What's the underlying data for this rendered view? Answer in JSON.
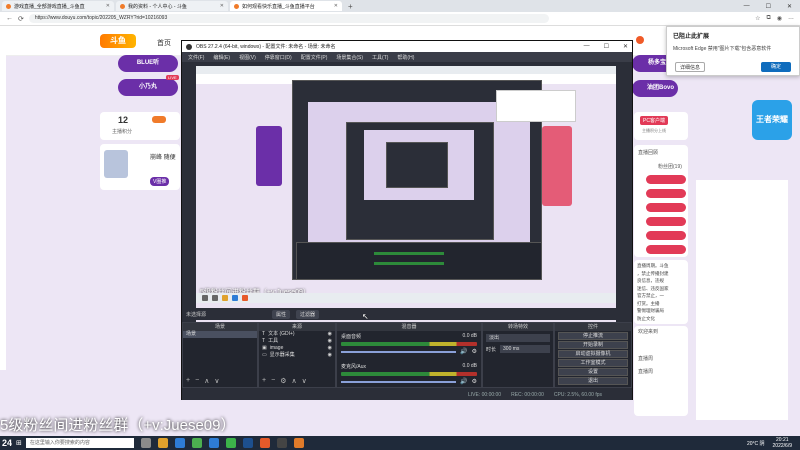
{
  "browser": {
    "tabs": [
      {
        "label": "游戏直播_全部游戏直播_斗鱼直",
        "active": false
      },
      {
        "label": "我的资料 - 个人中心 - 斗鱼",
        "active": false
      },
      {
        "label": "如何观看快乐直播_斗鱼直播平台",
        "active": true
      }
    ],
    "url": "https://www.douyu.com/topic/202205_WZRY?rid=10216093",
    "back": "←",
    "refresh": "⟳"
  },
  "douyu": {
    "logo": "斗鱼",
    "home": "首页",
    "pill_left_1": "BLUE听",
    "pill_left_2": "小乃丸",
    "live_badge": "LIVE",
    "stat_num": "12",
    "stat_label": "主播积分",
    "pill_right_1": "杨多宝·王",
    "pill_right_2": "油团Bovo",
    "pc_download": "PC客户端",
    "pc_download_sub": "主播积分上线",
    "right_promo": "王者荣耀",
    "list_title_1": "直播回顾",
    "list_title_2": "粉丝团(19)",
    "notice_fragments": [
      "直播周期。斗鱼",
      "，禁止传播封建",
      "良信息，违规",
      "迷信、违反国家",
      "官方禁止，一",
      "打赏。主播",
      "警惕理财骗局",
      "防止文化"
    ],
    "promo_text": "欢迎来到",
    "left_user": "崩峰 随便",
    "vip_badge": "V圈推",
    "sidebar_labels": [
      "直播周",
      "直播周"
    ]
  },
  "obs": {
    "title": "OBS 27.2.4 (64-bit, windows) - 配置文件: 未命名 - 场景: 未命名",
    "menu": [
      "文件(F)",
      "编辑(E)",
      "视图(V)",
      "停靠窗口(D)",
      "配置文件(P)",
      "场景集合(S)",
      "工具(T)",
      "帮助(H)"
    ],
    "scene_label": "未选择源",
    "toolbar_buttons": [
      "属性",
      "过滤器"
    ],
    "docks": {
      "scenes": {
        "title": "场景",
        "items": [
          "场景"
        ]
      },
      "sources": {
        "title": "来源",
        "items": [
          "文本 (GDI+)",
          "工具",
          "image",
          "显示器采集"
        ]
      },
      "mixer": {
        "title": "混音器",
        "channels": [
          {
            "name": "桌面音频",
            "db": "0.0 dB"
          },
          {
            "name": "麦克风/Aux",
            "db": "0.0 dB"
          }
        ]
      },
      "transitions": {
        "title": "转场特效",
        "type": "淡出",
        "duration_label": "时长",
        "duration": "300 ms"
      },
      "controls": {
        "title": "控件",
        "buttons": [
          "停止推流",
          "开始录制",
          "启动虚拟摄像机",
          "工作室模式",
          "设置",
          "退出"
        ]
      }
    },
    "status": {
      "live": "LIVE: 00:00:00",
      "rec": "REC: 00:00:00",
      "cpu": "CPU: 2.5%, 60.00 fps"
    }
  },
  "edge_popup": {
    "title": "已阻止此扩展",
    "body": "Microsoft Edge 禁用\"图片下载\"包含恶意软件",
    "details_btn": "详细信息",
    "ok_btn": "确定"
  },
  "overlay": {
    "stream_text": "5级粉丝间进粉丝群（+v:Juese09）",
    "big_text": "5级粉丝间进粉丝群（+v:Juese09）",
    "score": "24"
  },
  "windows": {
    "search_placeholder": "在这里输入你要搜索的内容",
    "weather": "20°C 阴",
    "time": "20:21",
    "date": "2022/6/9"
  },
  "colors": {
    "douyu_purple": "#6b2fa8",
    "douyu_red": "#e23a57",
    "obs_bg": "#2b2e38",
    "edge_blue": "#0f6cbd"
  }
}
